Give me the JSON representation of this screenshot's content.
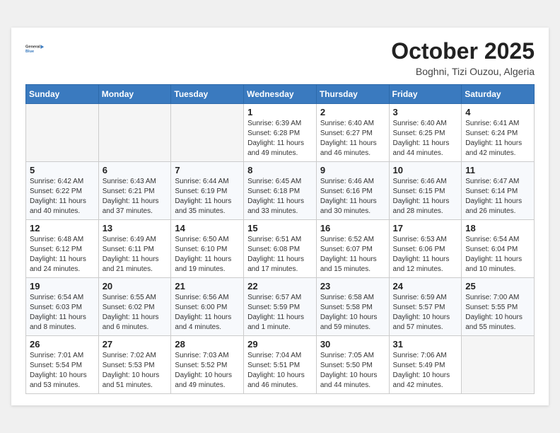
{
  "header": {
    "logo_line1": "General",
    "logo_line2": "Blue",
    "month_title": "October 2025",
    "location": "Boghni, Tizi Ouzou, Algeria"
  },
  "weekdays": [
    "Sunday",
    "Monday",
    "Tuesday",
    "Wednesday",
    "Thursday",
    "Friday",
    "Saturday"
  ],
  "weeks": [
    [
      {
        "day": "",
        "info": ""
      },
      {
        "day": "",
        "info": ""
      },
      {
        "day": "",
        "info": ""
      },
      {
        "day": "1",
        "info": "Sunrise: 6:39 AM\nSunset: 6:28 PM\nDaylight: 11 hours\nand 49 minutes."
      },
      {
        "day": "2",
        "info": "Sunrise: 6:40 AM\nSunset: 6:27 PM\nDaylight: 11 hours\nand 46 minutes."
      },
      {
        "day": "3",
        "info": "Sunrise: 6:40 AM\nSunset: 6:25 PM\nDaylight: 11 hours\nand 44 minutes."
      },
      {
        "day": "4",
        "info": "Sunrise: 6:41 AM\nSunset: 6:24 PM\nDaylight: 11 hours\nand 42 minutes."
      }
    ],
    [
      {
        "day": "5",
        "info": "Sunrise: 6:42 AM\nSunset: 6:22 PM\nDaylight: 11 hours\nand 40 minutes."
      },
      {
        "day": "6",
        "info": "Sunrise: 6:43 AM\nSunset: 6:21 PM\nDaylight: 11 hours\nand 37 minutes."
      },
      {
        "day": "7",
        "info": "Sunrise: 6:44 AM\nSunset: 6:19 PM\nDaylight: 11 hours\nand 35 minutes."
      },
      {
        "day": "8",
        "info": "Sunrise: 6:45 AM\nSunset: 6:18 PM\nDaylight: 11 hours\nand 33 minutes."
      },
      {
        "day": "9",
        "info": "Sunrise: 6:46 AM\nSunset: 6:16 PM\nDaylight: 11 hours\nand 30 minutes."
      },
      {
        "day": "10",
        "info": "Sunrise: 6:46 AM\nSunset: 6:15 PM\nDaylight: 11 hours\nand 28 minutes."
      },
      {
        "day": "11",
        "info": "Sunrise: 6:47 AM\nSunset: 6:14 PM\nDaylight: 11 hours\nand 26 minutes."
      }
    ],
    [
      {
        "day": "12",
        "info": "Sunrise: 6:48 AM\nSunset: 6:12 PM\nDaylight: 11 hours\nand 24 minutes."
      },
      {
        "day": "13",
        "info": "Sunrise: 6:49 AM\nSunset: 6:11 PM\nDaylight: 11 hours\nand 21 minutes."
      },
      {
        "day": "14",
        "info": "Sunrise: 6:50 AM\nSunset: 6:10 PM\nDaylight: 11 hours\nand 19 minutes."
      },
      {
        "day": "15",
        "info": "Sunrise: 6:51 AM\nSunset: 6:08 PM\nDaylight: 11 hours\nand 17 minutes."
      },
      {
        "day": "16",
        "info": "Sunrise: 6:52 AM\nSunset: 6:07 PM\nDaylight: 11 hours\nand 15 minutes."
      },
      {
        "day": "17",
        "info": "Sunrise: 6:53 AM\nSunset: 6:06 PM\nDaylight: 11 hours\nand 12 minutes."
      },
      {
        "day": "18",
        "info": "Sunrise: 6:54 AM\nSunset: 6:04 PM\nDaylight: 11 hours\nand 10 minutes."
      }
    ],
    [
      {
        "day": "19",
        "info": "Sunrise: 6:54 AM\nSunset: 6:03 PM\nDaylight: 11 hours\nand 8 minutes."
      },
      {
        "day": "20",
        "info": "Sunrise: 6:55 AM\nSunset: 6:02 PM\nDaylight: 11 hours\nand 6 minutes."
      },
      {
        "day": "21",
        "info": "Sunrise: 6:56 AM\nSunset: 6:00 PM\nDaylight: 11 hours\nand 4 minutes."
      },
      {
        "day": "22",
        "info": "Sunrise: 6:57 AM\nSunset: 5:59 PM\nDaylight: 11 hours\nand 1 minute."
      },
      {
        "day": "23",
        "info": "Sunrise: 6:58 AM\nSunset: 5:58 PM\nDaylight: 10 hours\nand 59 minutes."
      },
      {
        "day": "24",
        "info": "Sunrise: 6:59 AM\nSunset: 5:57 PM\nDaylight: 10 hours\nand 57 minutes."
      },
      {
        "day": "25",
        "info": "Sunrise: 7:00 AM\nSunset: 5:55 PM\nDaylight: 10 hours\nand 55 minutes."
      }
    ],
    [
      {
        "day": "26",
        "info": "Sunrise: 7:01 AM\nSunset: 5:54 PM\nDaylight: 10 hours\nand 53 minutes."
      },
      {
        "day": "27",
        "info": "Sunrise: 7:02 AM\nSunset: 5:53 PM\nDaylight: 10 hours\nand 51 minutes."
      },
      {
        "day": "28",
        "info": "Sunrise: 7:03 AM\nSunset: 5:52 PM\nDaylight: 10 hours\nand 49 minutes."
      },
      {
        "day": "29",
        "info": "Sunrise: 7:04 AM\nSunset: 5:51 PM\nDaylight: 10 hours\nand 46 minutes."
      },
      {
        "day": "30",
        "info": "Sunrise: 7:05 AM\nSunset: 5:50 PM\nDaylight: 10 hours\nand 44 minutes."
      },
      {
        "day": "31",
        "info": "Sunrise: 7:06 AM\nSunset: 5:49 PM\nDaylight: 10 hours\nand 42 minutes."
      },
      {
        "day": "",
        "info": ""
      }
    ]
  ]
}
